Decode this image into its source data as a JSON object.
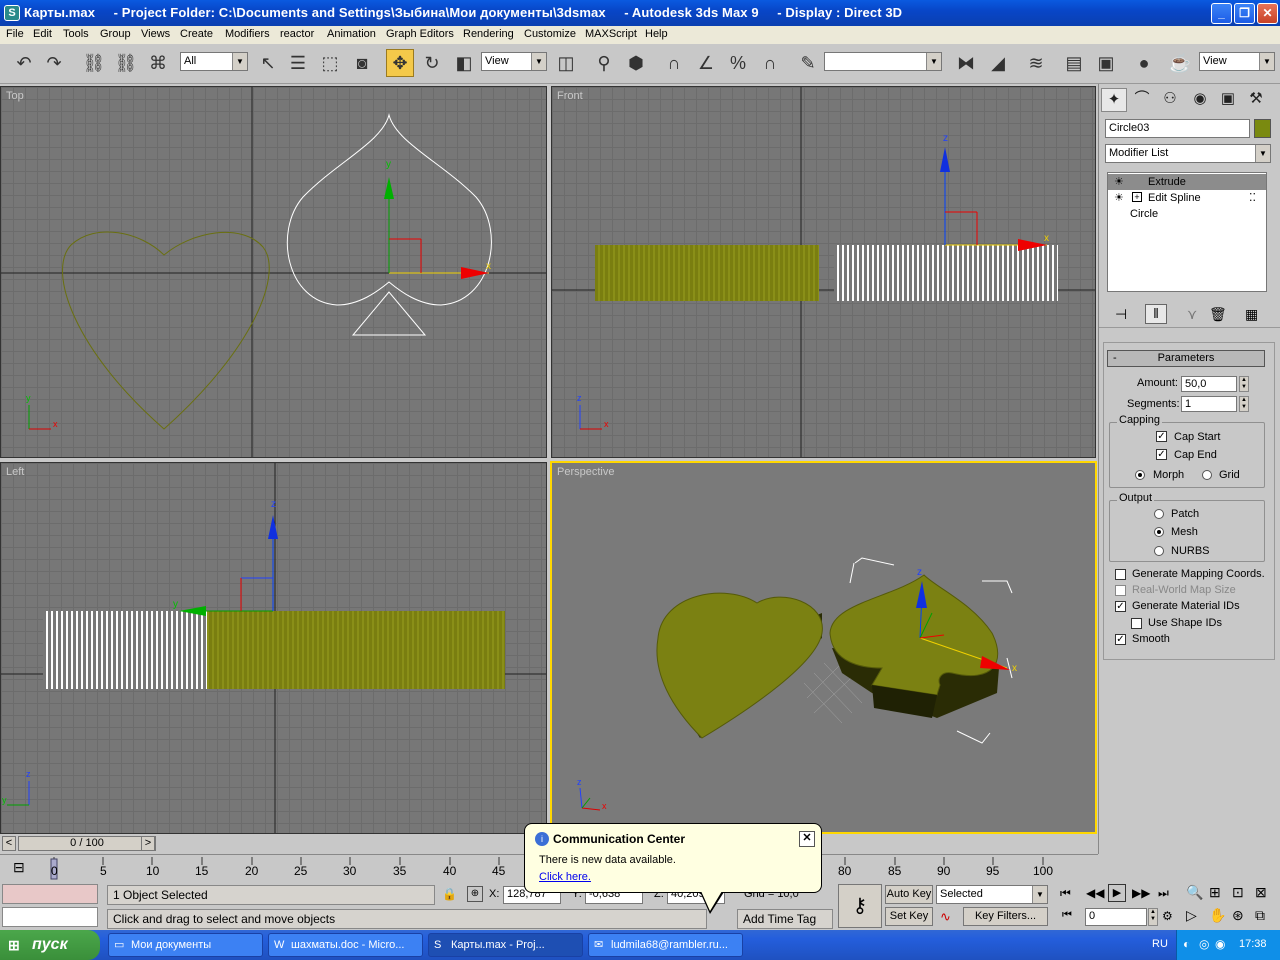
{
  "window": {
    "title": "Карты.max     - Project Folder: C:\\Documents and Settings\\Зыбина\\Мои документы\\3dsmax     - Autodesk 3ds Max 9     - Display : Direct 3D",
    "minimize": "_",
    "maximize": "❐",
    "close": "✕"
  },
  "menu": [
    "File",
    "Edit",
    "Tools",
    "Group",
    "Views",
    "Create",
    "Modifiers",
    "reactor",
    "Animation",
    "Graph Editors",
    "Rendering",
    "Customize",
    "MAXScript",
    "Help"
  ],
  "toolbar": {
    "selection_filter": "All",
    "ref_coord": "View",
    "named_selection": "",
    "render_view": "View"
  },
  "viewports": {
    "top": "Top",
    "front": "Front",
    "left": "Left",
    "perspective": "Perspective"
  },
  "axis": {
    "x": "x",
    "y": "y",
    "z": "z"
  },
  "command_panel": {
    "object_name": "Circle03",
    "object_color": "#7a8a10",
    "modifier_list": "Modifier List",
    "stack": [
      "Extrude",
      "Edit Spline",
      "Circle"
    ],
    "rollout": "Parameters",
    "amount_label": "Amount:",
    "amount": "50,0",
    "segments_label": "Segments:",
    "segments": "1",
    "capping_title": "Capping",
    "cap_start": "Cap Start",
    "cap_end": "Cap End",
    "morph": "Morph",
    "grid": "Grid",
    "output_title": "Output",
    "patch": "Patch",
    "mesh": "Mesh",
    "nurbs": "NURBS",
    "gen_mapping": "Generate Mapping Coords.",
    "real_world": "Real-World Map Size",
    "gen_mat_ids": "Generate Material IDs",
    "use_shape_ids": "Use Shape IDs",
    "smooth": "Smooth"
  },
  "timeline": {
    "slider": "0 / 100",
    "ticks": [
      "0",
      "5",
      "10",
      "15",
      "20",
      "25",
      "30",
      "35",
      "40",
      "45",
      "80",
      "85",
      "90",
      "95",
      "100"
    ]
  },
  "status": {
    "selected": "1 Object Selected",
    "prompt": "Click and drag to select and move objects",
    "x_label": "X:",
    "x": "128,787",
    "y_label": "Y:",
    "y": "-0,638",
    "z_label": "Z:",
    "z": "40,209",
    "grid": "Grid = 10,0",
    "add_time_tag": "Add Time Tag",
    "auto_key": "Auto Key",
    "set_key": "Set Key",
    "key_mode": "Selected",
    "key_filters": "Key Filters...",
    "frame": "0"
  },
  "balloon": {
    "title": "Communication Center",
    "text": "There is new data available.",
    "link": "Click here."
  },
  "taskbar": {
    "start": "пуск",
    "items": [
      "Мои документы",
      "шахматы.doc - Micro...",
      "Карты.max     - Proj...",
      "ludmila68@rambler.ru..."
    ],
    "lang": "RU",
    "clock": "17:38"
  }
}
